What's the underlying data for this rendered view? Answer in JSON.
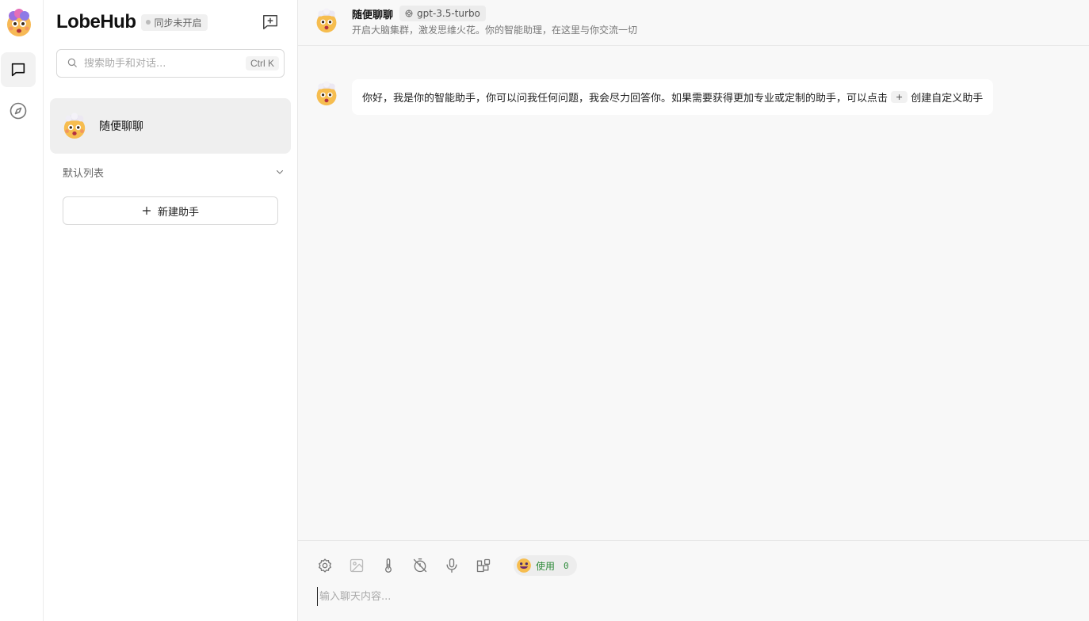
{
  "colors": {
    "accent": "#2e8b3a",
    "active_bg": "#efefef",
    "main_bg": "#f8f8f8"
  },
  "rail": {
    "avatar_icon": "user-avatar-emoji-icon",
    "nav": [
      {
        "icon": "chat-bubble-icon",
        "active": true
      },
      {
        "icon": "compass-icon",
        "active": false
      }
    ]
  },
  "sidebar": {
    "brand": "LobeHub",
    "sync_status": "同步未开启",
    "search": {
      "placeholder": "搜索助手和对话...",
      "shortcut": "Ctrl K"
    },
    "sessions": [
      {
        "title": "随便聊聊",
        "avatar_icon": "mind-blown-emoji-icon",
        "active": true
      }
    ],
    "group": {
      "label": "默认列表",
      "expanded": true
    },
    "add_assistant_label": "新建助手"
  },
  "chat": {
    "header": {
      "title": "随便聊聊",
      "model": "gpt-3.5-turbo",
      "description": "开启大脑集群，激发思维火花。你的智能助理，在这里与你交流一切"
    },
    "messages": [
      {
        "role": "assistant",
        "text_before": "你好，我是你的智能助手，你可以问我任何问题，我会尽力回答你。如果需要获得更加专业或定制的助手，可以点击",
        "inline_button": "+",
        "text_after": "创建自定义助手"
      }
    ],
    "input": {
      "placeholder": "输入聊天内容...",
      "tools": [
        "settings-icon",
        "image-icon",
        "thermometer-icon",
        "timer-off-icon",
        "microphone-icon",
        "plugins-icon"
      ],
      "token_usage": {
        "label": "使用",
        "count": "0"
      }
    }
  }
}
